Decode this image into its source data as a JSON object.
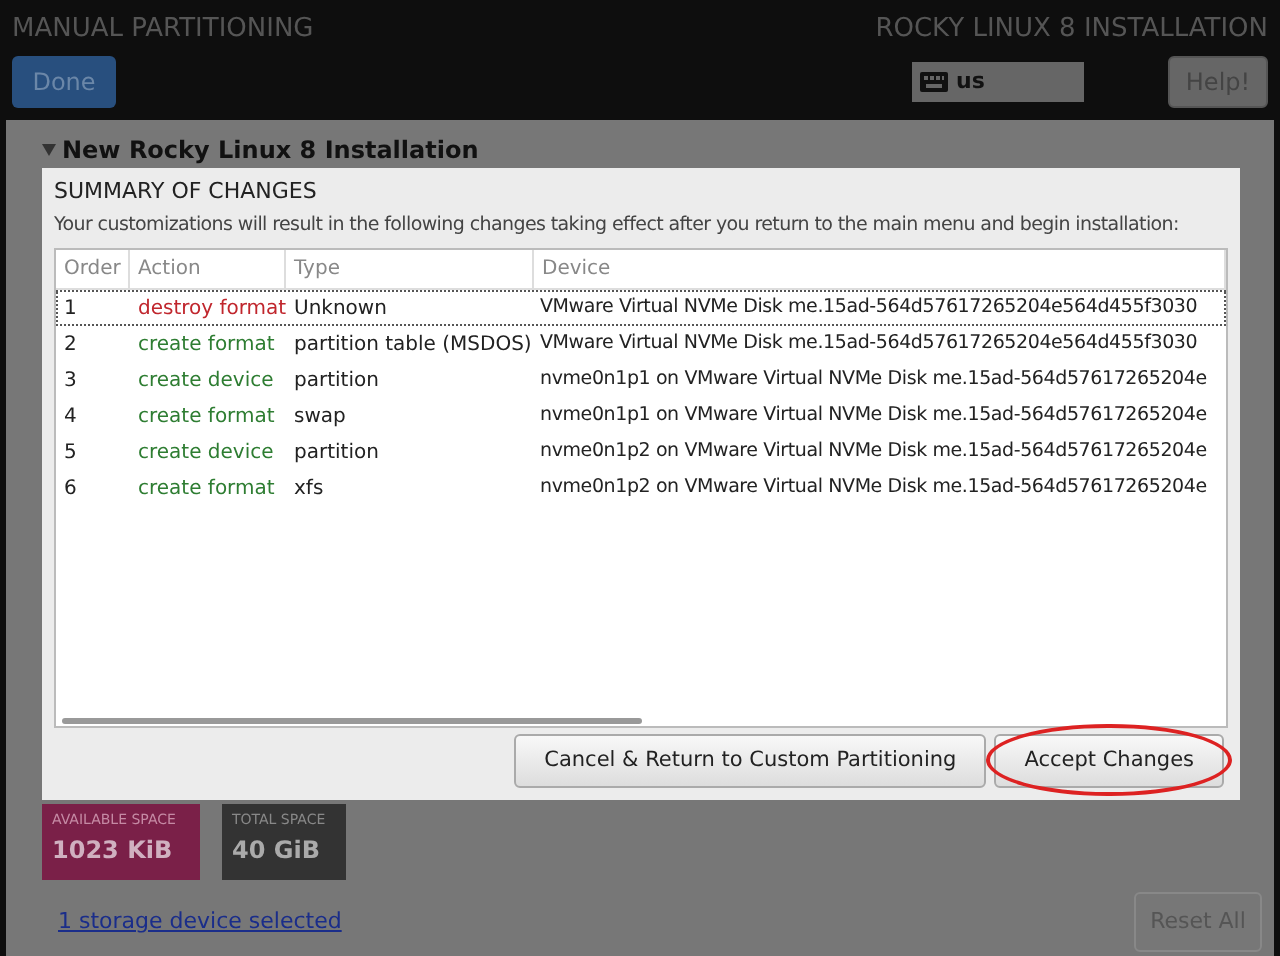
{
  "header": {
    "title": "MANUAL PARTITIONING",
    "done_button": "Done",
    "product": "ROCKY LINUX 8 INSTALLATION",
    "keyboard_layout": "us",
    "help_button": "Help!"
  },
  "background": {
    "section_title": "New Rocky Linux 8 Installation",
    "available_space": {
      "label": "AVAILABLE SPACE",
      "value": "1023 KiB"
    },
    "total_space": {
      "label": "TOTAL SPACE",
      "value": "40 GiB"
    },
    "storage_link": "1 storage device selected",
    "reset_button": "Reset All"
  },
  "dialog": {
    "title": "SUMMARY OF CHANGES",
    "message": "Your customizations will result in the following changes taking effect after you return to the main menu and begin installation:",
    "table": {
      "columns": [
        "Order",
        "Action",
        "Type",
        "Device"
      ],
      "rows": [
        {
          "order": "1",
          "action": "destroy format",
          "kind": "destroy",
          "type": "Unknown",
          "device": "VMware Virtual NVMe Disk me.15ad-564d57617265204e564d455f3030",
          "selected": true
        },
        {
          "order": "2",
          "action": "create format",
          "kind": "create",
          "type": "partition table (MSDOS)",
          "device": "VMware Virtual NVMe Disk me.15ad-564d57617265204e564d455f3030",
          "selected": false
        },
        {
          "order": "3",
          "action": "create device",
          "kind": "create",
          "type": "partition",
          "device": "nvme0n1p1 on VMware Virtual NVMe Disk me.15ad-564d57617265204e",
          "selected": false
        },
        {
          "order": "4",
          "action": "create format",
          "kind": "create",
          "type": "swap",
          "device": "nvme0n1p1 on VMware Virtual NVMe Disk me.15ad-564d57617265204e",
          "selected": false
        },
        {
          "order": "5",
          "action": "create device",
          "kind": "create",
          "type": "partition",
          "device": "nvme0n1p2 on VMware Virtual NVMe Disk me.15ad-564d57617265204e",
          "selected": false
        },
        {
          "order": "6",
          "action": "create format",
          "kind": "create",
          "type": "xfs",
          "device": "nvme0n1p2 on VMware Virtual NVMe Disk me.15ad-564d57617265204e",
          "selected": false
        }
      ]
    },
    "buttons": [
      {
        "label": "Cancel & Return to Custom Partitioning",
        "circled": false
      },
      {
        "label": "Accept Changes",
        "circled": true
      }
    ]
  }
}
